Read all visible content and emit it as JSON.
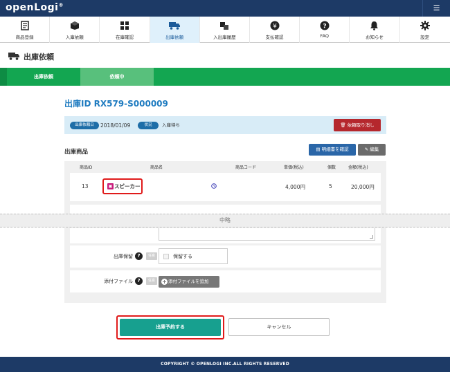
{
  "app": {
    "logo": "openLogi",
    "logo_mark": "®"
  },
  "nav": {
    "items": [
      {
        "label": "商品登録",
        "icon": "product-register-icon"
      },
      {
        "label": "入庫依頼",
        "icon": "inbound-request-icon"
      },
      {
        "label": "在庫確認",
        "icon": "inventory-icon"
      },
      {
        "label": "出庫依頼",
        "icon": "truck-icon",
        "active": true
      },
      {
        "label": "入出庫履歴",
        "icon": "history-icon"
      },
      {
        "label": "支払確認",
        "icon": "yen-icon"
      },
      {
        "label": "FAQ",
        "icon": "question-icon"
      },
      {
        "label": "お知らせ",
        "icon": "bell-icon"
      },
      {
        "label": "設定",
        "icon": "gear-icon"
      }
    ]
  },
  "page": {
    "title": "出庫依頼"
  },
  "steps": [
    {
      "label": "出庫依頼"
    },
    {
      "label": "依頼中"
    }
  ],
  "order": {
    "id": "出庫ID RX579-S000009",
    "date_label": "出庫依頼日",
    "date_value": "2018/01/09",
    "status_label": "状況",
    "status_value": "入庫待ち",
    "cancel_request_label": "依頼取り消し"
  },
  "products_section": {
    "title": "出庫商品",
    "detail_button": "明細書を確認",
    "edit_button": "編集",
    "columns": [
      "商品ID",
      "商品名",
      "商品コード",
      "単価(税込)",
      "個数",
      "金額(税込)"
    ],
    "rows": [
      {
        "id": "13",
        "name": "スピーカー",
        "code": "",
        "unit_price": "4,000円",
        "qty": "5",
        "amount": "20,000円"
      }
    ]
  },
  "omitted_label": "中略",
  "form": {
    "hold_label": "出庫保留",
    "hold_option_label": "保留する",
    "attach_label": "添付ファイル",
    "attach_button": "添付ファイルを追加",
    "optional_badge": "任意",
    "help_glyph": "?"
  },
  "actions": {
    "submit": "出庫予約する",
    "cancel": "キャンセル"
  },
  "footer": {
    "copyright": "COPYRIGHT © OPENLOGI INC.ALL RIGHTS RESERVED"
  },
  "colors": {
    "header_bg": "#1d3a66",
    "step_green": "#13a651",
    "accent_blue": "#1e7bc0",
    "submit_teal": "#17a08f",
    "danger_red": "#b5272d",
    "highlight_red": "#e01a1a"
  }
}
